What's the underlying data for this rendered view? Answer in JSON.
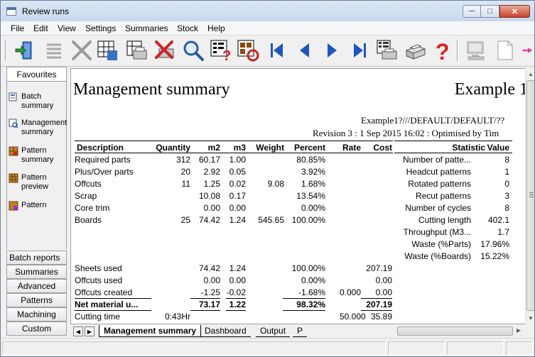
{
  "window": {
    "title": "Review runs"
  },
  "menu": [
    "File",
    "Edit",
    "View",
    "Settings",
    "Summaries",
    "Stock",
    "Help"
  ],
  "toolbar": {
    "icons": [
      "exit-icon",
      "list-icon",
      "scissors-icon",
      "pattern-icon",
      "pattern-print-icon",
      "delete-print-icon",
      "magnify-icon",
      "summary-help-icon",
      "summary-refresh-icon",
      "first-icon",
      "previous-icon",
      "next-icon",
      "last-icon",
      "grid-print-icon",
      "printer-icon",
      "help-icon",
      "computer-icon",
      "page-icon"
    ]
  },
  "sidebar": {
    "header": "Favourites",
    "favourites": [
      {
        "label": "Batch summary",
        "icon": "batch-summary-icon"
      },
      {
        "label": "Management summary",
        "icon": "management-summary-icon"
      },
      {
        "label": "Pattern summary",
        "icon": "pattern-summary-icon"
      },
      {
        "label": "Pattern preview",
        "icon": "pattern-preview-icon"
      },
      {
        "label": "Pattern",
        "icon": "pattern-icon"
      }
    ],
    "tabs": [
      "Batch reports",
      "Summaries",
      "Advanced",
      "Patterns",
      "Machining",
      "Custom"
    ]
  },
  "report": {
    "title": "Management summary",
    "example": "Example 1",
    "path": "Example1?///DEFAULT/DEFAULT/??",
    "revision": "Revision 3 : 1 Sep 2015 16:02 : Optimised by Tim",
    "columns": [
      "Description",
      "Quantity",
      "m2",
      "m3",
      "Weight",
      "Percent",
      "Rate",
      "Cost"
    ],
    "rows": [
      [
        "Required parts",
        "312",
        "60.17",
        "1.00",
        "",
        "80.85%",
        "",
        ""
      ],
      [
        "Plus/Over parts",
        "20",
        "2.92",
        "0.05",
        "",
        "3.92%",
        "",
        ""
      ],
      [
        "Offcuts",
        "11",
        "1.25",
        "0.02",
        "9.08",
        "1.68%",
        "",
        ""
      ],
      [
        "Scrap",
        "",
        "10.08",
        "0.17",
        "",
        "13.54%",
        "",
        ""
      ],
      [
        "Core trim",
        "",
        "0.00",
        "0.00",
        "",
        "0.00%",
        "",
        ""
      ],
      [
        "Boards",
        "25",
        "74.42",
        "1.24",
        "545.65",
        "100.00%",
        "",
        ""
      ]
    ],
    "usage_rows": [
      [
        "Sheets used",
        "",
        "74.42",
        "1.24",
        "",
        "100.00%",
        "",
        "207.19"
      ],
      [
        "Offcuts used",
        "",
        "0.00",
        "0.00",
        "",
        "0.00%",
        "",
        "0.00"
      ],
      [
        "Offcuts created",
        "",
        "-1.25",
        "-0.02",
        "",
        "-1.68%",
        "0.000",
        "0.00"
      ]
    ],
    "net_row": [
      "Net material u...",
      "",
      "73.17",
      "1.22",
      "",
      "98.32%",
      "",
      "207.19"
    ],
    "time_row": [
      "Cutting time",
      "0:43Hr",
      "",
      "",
      "",
      "",
      "50.000",
      "35.89"
    ],
    "stats_columns": [
      "Statistic",
      "Value"
    ],
    "stats": [
      [
        "Number of patte...",
        "8"
      ],
      [
        "Headcut patterns",
        "1"
      ],
      [
        "Rotated patterns",
        "0"
      ],
      [
        "Recut patterns",
        "3"
      ],
      [
        "Number of cycles",
        "8"
      ],
      [
        "Cutting length",
        "402.1"
      ],
      [
        "Throughput (M3...",
        "1.7"
      ],
      [
        "Waste (%Parts)",
        "17.96%"
      ],
      [
        "Waste (%Boards)",
        "15.22%"
      ]
    ]
  },
  "sheet_tabs": [
    "Management summary",
    "Dashboard",
    "Output",
    "P"
  ]
}
